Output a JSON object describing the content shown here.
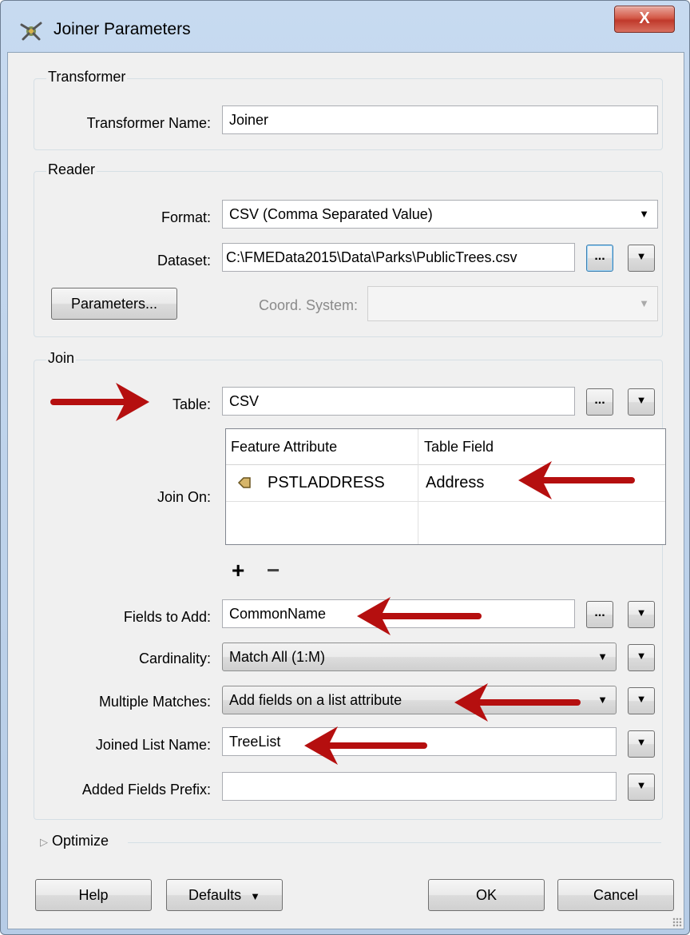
{
  "window": {
    "title": "Joiner Parameters",
    "close_symbol": "X"
  },
  "transformer": {
    "group_title": "Transformer",
    "name_label": "Transformer Name:",
    "name_value": "Joiner"
  },
  "reader": {
    "group_title": "Reader",
    "format_label": "Format:",
    "format_value": "CSV (Comma Separated Value)",
    "dataset_label": "Dataset:",
    "dataset_value": "C:\\FMEData2015\\Data\\Parks\\PublicTrees.csv",
    "parameters_button": "Parameters...",
    "coord_label": "Coord. System:",
    "coord_value": ""
  },
  "join": {
    "group_title": "Join",
    "table_label": "Table:",
    "table_value": "CSV",
    "join_on_label": "Join On:",
    "columns": [
      "Feature Attribute",
      "Table Field"
    ],
    "rows": [
      {
        "feature_attribute": "PSTLADDRESS",
        "table_field": "Address"
      }
    ],
    "add_symbol": "+",
    "remove_symbol": "−",
    "fields_to_add_label": "Fields to Add:",
    "fields_to_add_value": "CommonName",
    "cardinality_label": "Cardinality:",
    "cardinality_value": "Match All (1:M)",
    "multiple_matches_label": "Multiple Matches:",
    "multiple_matches_value": "Add fields on a list attribute",
    "joined_list_name_label": "Joined List Name:",
    "joined_list_name_value": "TreeList",
    "added_fields_prefix_label": "Added Fields Prefix:",
    "added_fields_prefix_value": ""
  },
  "optimize": {
    "label": "Optimize"
  },
  "buttons": {
    "help": "Help",
    "defaults": "Defaults",
    "ok": "OK",
    "cancel": "Cancel",
    "ellipsis": "...",
    "dropdown_symbol": "▼"
  },
  "colors": {
    "annotation_arrow": "#b50f0f",
    "title_bar": "#c7daf0"
  }
}
